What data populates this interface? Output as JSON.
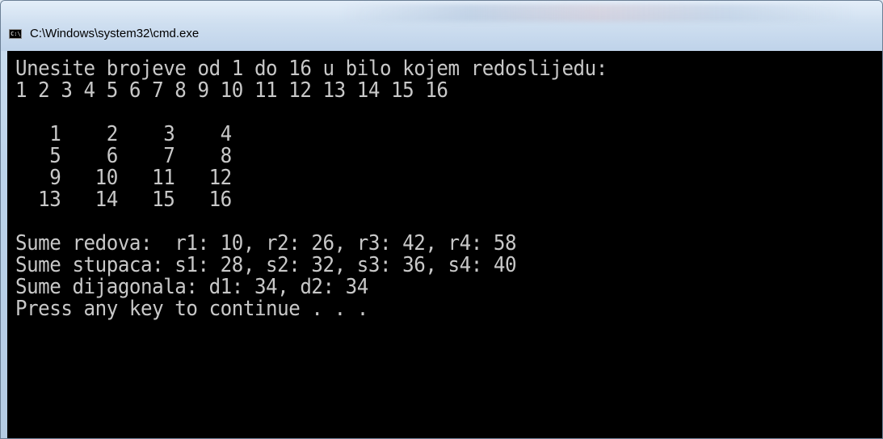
{
  "window": {
    "title": "C:\\Windows\\system32\\cmd.exe",
    "icon": "cmd-icon",
    "icon_glyph": "C:\\"
  },
  "console": {
    "lines": [
      "Unesite brojeve od 1 do 16 u bilo kojem redoslijedu:",
      "1 2 3 4 5 6 7 8 9 10 11 12 13 14 15 16",
      "",
      "   1    2    3    4",
      "   5    6    7    8",
      "   9   10   11   12",
      "  13   14   15   16",
      "",
      "Sume redova:  r1: 10, r2: 26, r3: 42, r4: 58",
      "Sume stupaca: s1: 28, s2: 32, s3: 36, s4: 40",
      "Sume dijagonala: d1: 34, d2: 34",
      "Press any key to continue . . ."
    ]
  }
}
